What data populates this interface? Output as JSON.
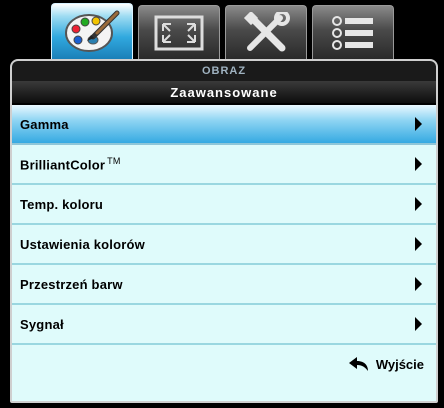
{
  "tabs": [
    {
      "icon": "palette-icon",
      "active": true
    },
    {
      "icon": "resize-icon",
      "active": false
    },
    {
      "icon": "tools-icon",
      "active": false
    },
    {
      "icon": "list-icon",
      "active": false
    }
  ],
  "header": {
    "section": "OBRAZ",
    "title": "Zaawansowane"
  },
  "menu": {
    "items": [
      {
        "label": "Gamma",
        "selected": true
      },
      {
        "label": "BrilliantColor",
        "superscript": "TM",
        "selected": false
      },
      {
        "label": "Temp. koloru",
        "selected": false
      },
      {
        "label": "Ustawienia kolorów",
        "selected": false
      },
      {
        "label": "Przestrzeń barw",
        "selected": false
      },
      {
        "label": "Sygnał",
        "selected": false
      }
    ]
  },
  "footer": {
    "exit_label": "Wyjście",
    "exit_icon": "return-arrow-icon"
  },
  "colors": {
    "accent": "#35a9e2",
    "panel_bg": "#dffbfb"
  }
}
